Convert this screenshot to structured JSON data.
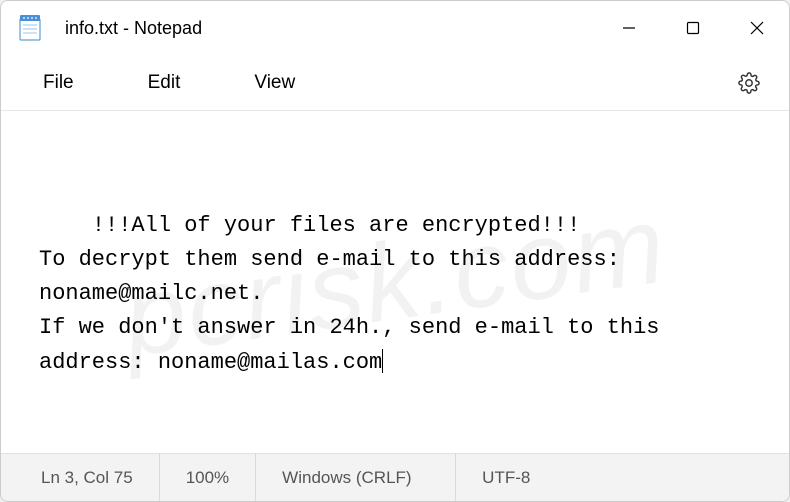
{
  "titlebar": {
    "title": "info.txt - Notepad"
  },
  "menubar": {
    "file": "File",
    "edit": "Edit",
    "view": "View"
  },
  "editor": {
    "content": "!!!All of your files are encrypted!!!\nTo decrypt them send e-mail to this address: noname@mailc.net.\nIf we don't answer in 24h., send e-mail to this address: noname@mailas.com"
  },
  "statusbar": {
    "position": "Ln 3, Col 75",
    "zoom": "100%",
    "lineending": "Windows (CRLF)",
    "encoding": "UTF-8"
  }
}
